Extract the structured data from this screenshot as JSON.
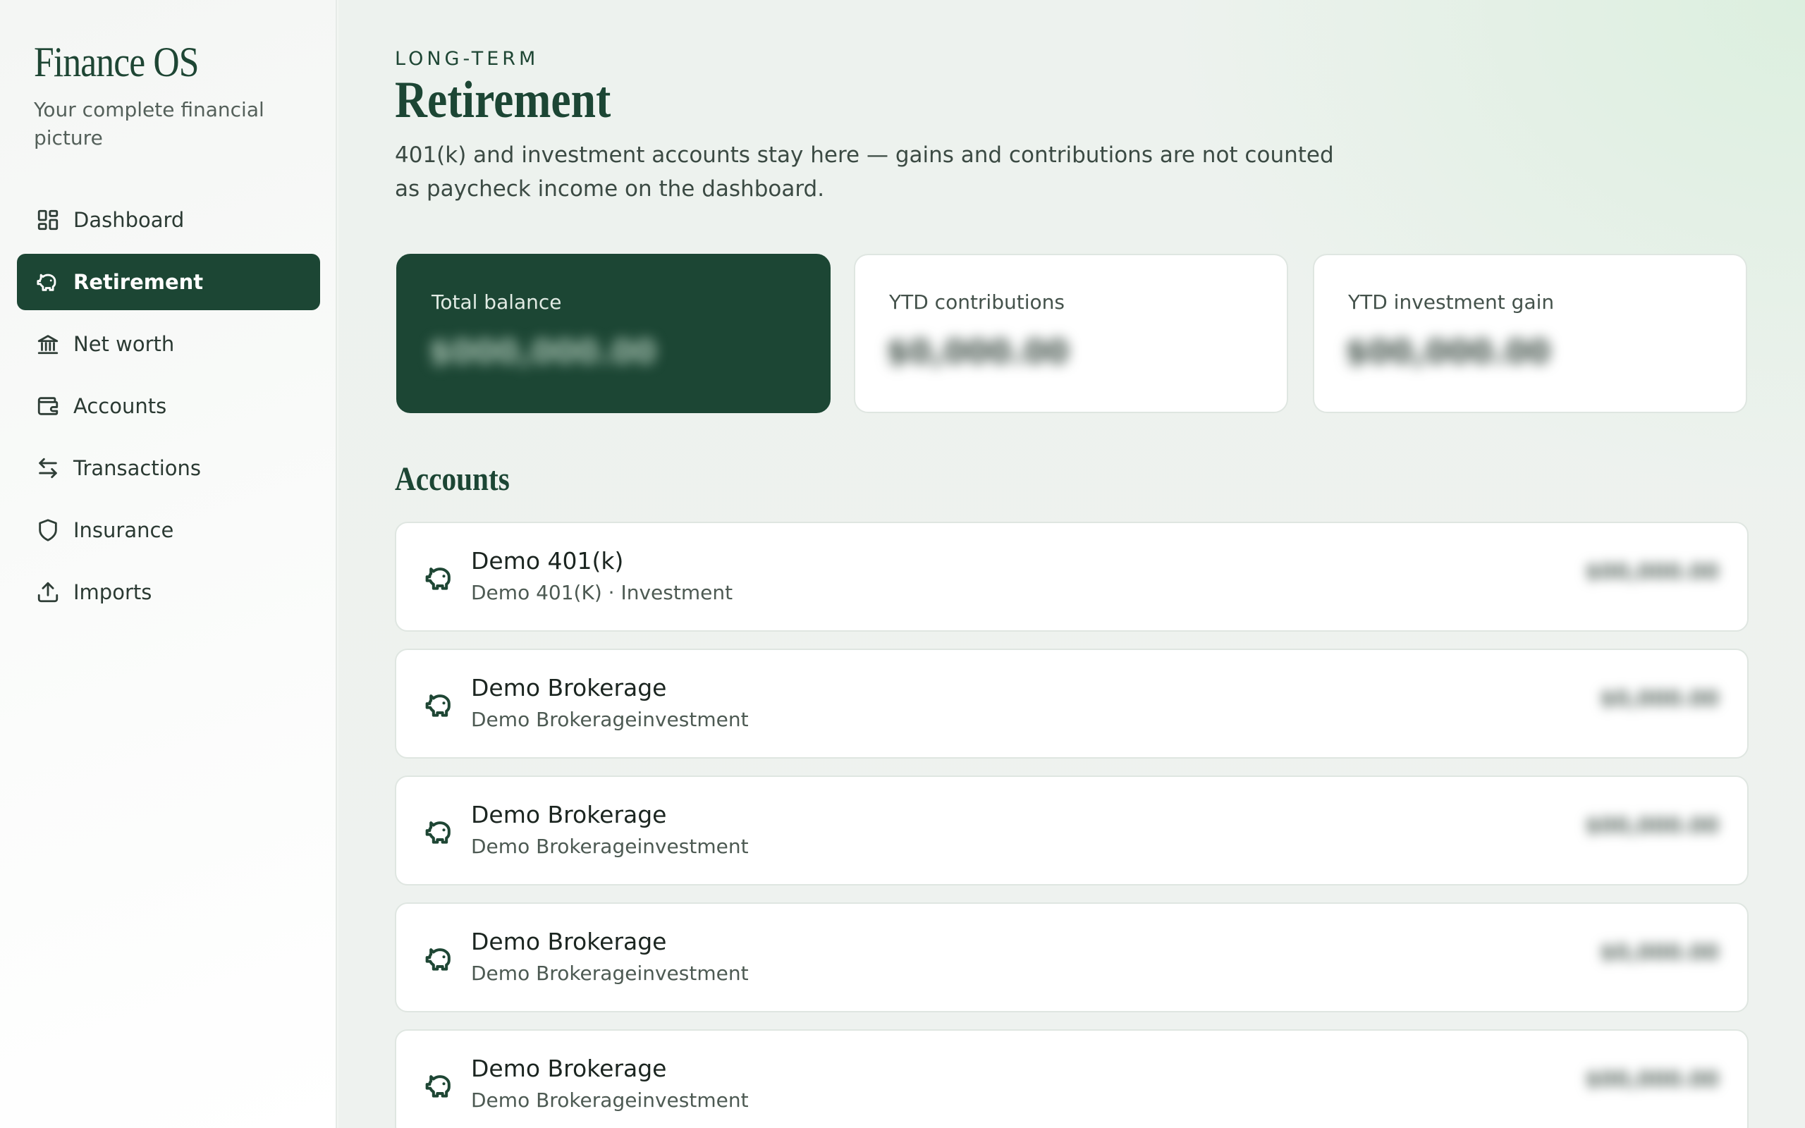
{
  "brand": {
    "title": "Finance OS",
    "subtitle": "Your complete financial picture"
  },
  "nav": [
    {
      "label": "Dashboard",
      "icon": "dashboard-icon",
      "active": false
    },
    {
      "label": "Retirement",
      "icon": "piggy-bank-icon",
      "active": true
    },
    {
      "label": "Net worth",
      "icon": "bank-icon",
      "active": false
    },
    {
      "label": "Accounts",
      "icon": "wallet-icon",
      "active": false
    },
    {
      "label": "Transactions",
      "icon": "arrows-swap-icon",
      "active": false
    },
    {
      "label": "Insurance",
      "icon": "shield-icon",
      "active": false
    },
    {
      "label": "Imports",
      "icon": "upload-icon",
      "active": false
    }
  ],
  "header": {
    "eyebrow": "LONG-TERM",
    "title": "Retirement",
    "description": "401(k) and investment accounts stay here — gains and contributions are not counted as paycheck income on the dashboard."
  },
  "stats": [
    {
      "label": "Total balance",
      "value": "$000,000.00"
    },
    {
      "label": "YTD contributions",
      "value": "$0,000.00"
    },
    {
      "label": "YTD investment gain",
      "value": "$00,000.00"
    }
  ],
  "accounts_section": {
    "title": "Accounts",
    "items": [
      {
        "name": "Demo 401(k)",
        "sub": "Demo 401(K) · Investment",
        "balance": "$00,000.00"
      },
      {
        "name": "Demo Brokerage",
        "sub": "Demo Brokerageinvestment",
        "balance": "$0,000.00"
      },
      {
        "name": "Demo Brokerage",
        "sub": "Demo Brokerageinvestment",
        "balance": "$00,000.00"
      },
      {
        "name": "Demo Brokerage",
        "sub": "Demo Brokerageinvestment",
        "balance": "$0,000.00"
      },
      {
        "name": "Demo Brokerage",
        "sub": "Demo Brokerageinvestment",
        "balance": "$00,000.00"
      }
    ]
  },
  "colors": {
    "accent": "#1c4634",
    "background": "#eef2ef",
    "card": "#ffffff"
  }
}
